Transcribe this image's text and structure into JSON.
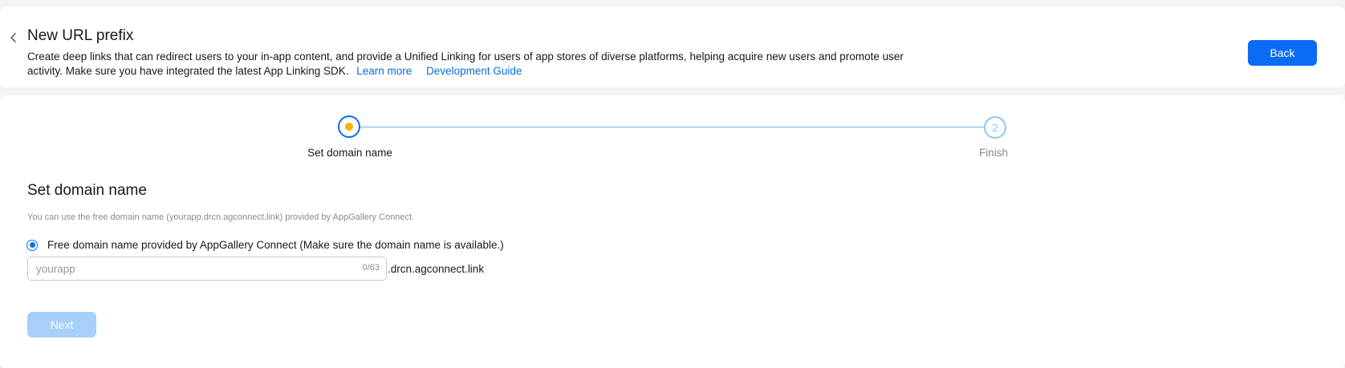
{
  "header": {
    "title": "New URL prefix",
    "description": "Create deep links that can redirect users to your in-app content, and provide a Unified Linking for users of app stores of diverse platforms, helping acquire new users and promote user activity. Make sure you have integrated the latest App Linking SDK.",
    "learn_more": "Learn more",
    "dev_guide": "Development Guide",
    "back_label": "Back"
  },
  "steps": [
    {
      "number": "1",
      "label": "Set domain name",
      "status": "active"
    },
    {
      "number": "2",
      "label": "Finish",
      "status": "pending"
    }
  ],
  "form": {
    "section_title": "Set domain name",
    "hint": "You can use the free domain name (yourapp.drcn.agconnect.link) provided by AppGallery Connect.",
    "radio_label": "Free domain name provided by AppGallery Connect (Make sure the domain name is available.)",
    "input_placeholder": "yourapp",
    "input_value": "",
    "char_count": "0/63",
    "domain_suffix": ".drcn.agconnect.link",
    "next_label": "Next"
  },
  "colors": {
    "primary": "#0a6cf5",
    "link": "#0a6cdc",
    "active_dot": "#f5b400",
    "step_line": "#66b7f5",
    "disabled_button": "#a6cffa"
  },
  "icons": {
    "back": "chevron-left-icon"
  }
}
